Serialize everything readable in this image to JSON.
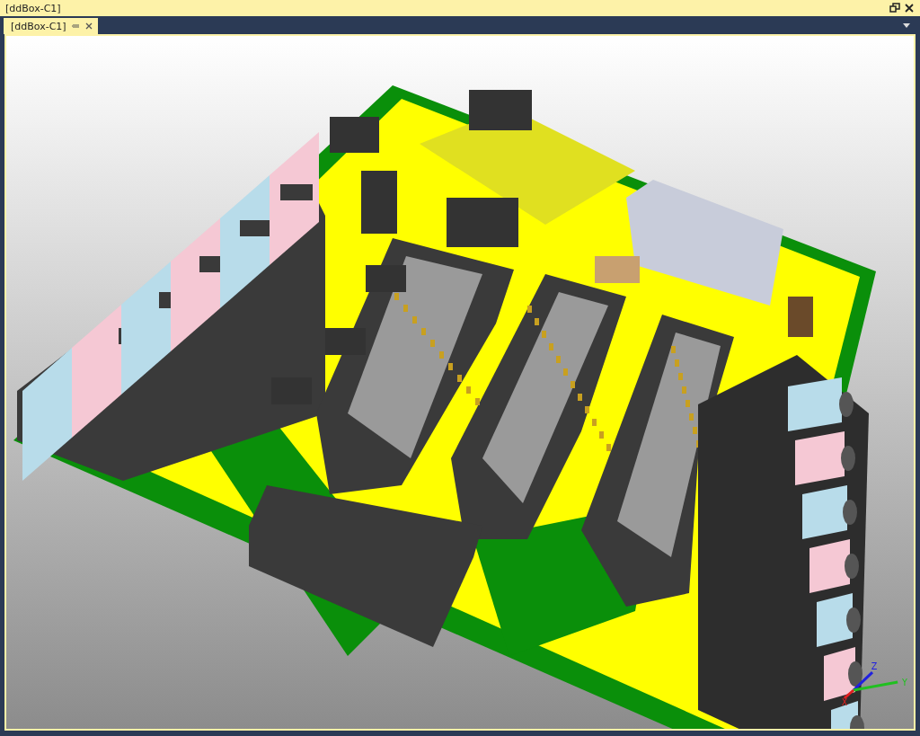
{
  "window": {
    "title": "[ddBox-C1]"
  },
  "tabs": [
    {
      "label": "[ddBox-C1]",
      "selected": true
    }
  ],
  "viewport": {
    "axes": [
      {
        "kind": "z",
        "label": "Z"
      },
      {
        "kind": "y",
        "label": "Y"
      },
      {
        "kind": "x",
        "label": "X"
      }
    ]
  }
}
